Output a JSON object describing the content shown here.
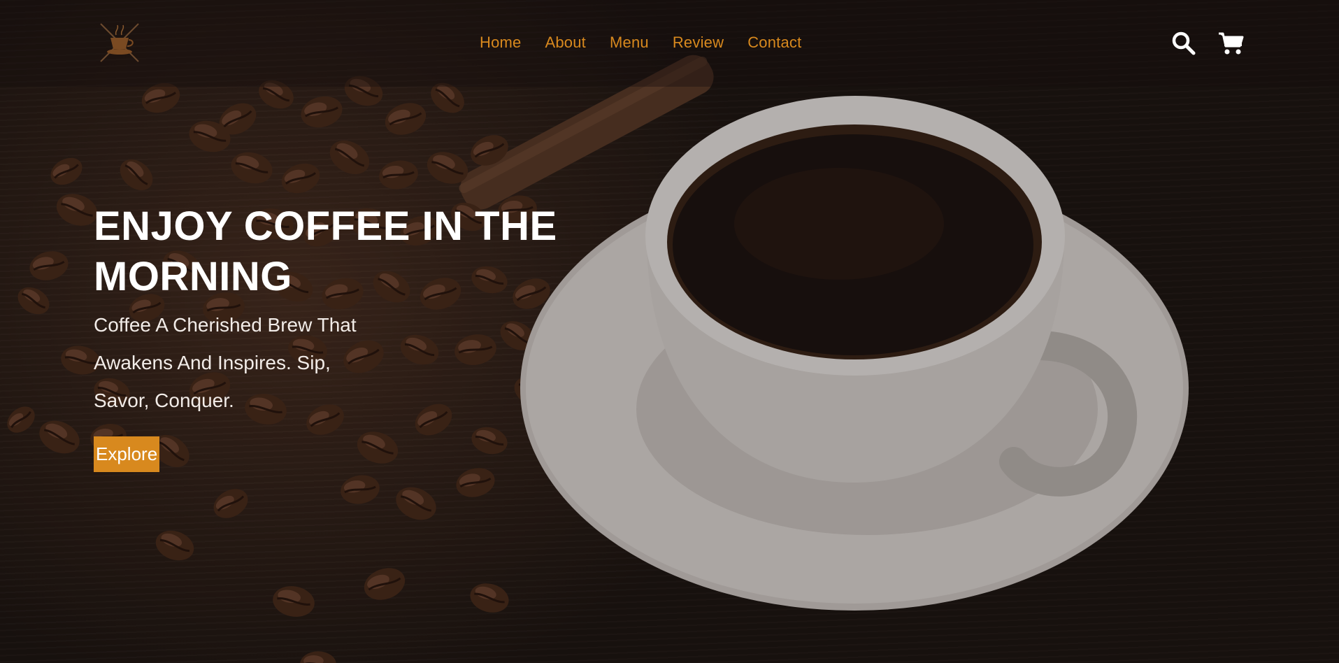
{
  "nav": {
    "logo_icon": "coffee-cup-logo-icon",
    "links": [
      {
        "label": "Home"
      },
      {
        "label": "About"
      },
      {
        "label": "Menu"
      },
      {
        "label": "Review"
      },
      {
        "label": "Contact"
      }
    ],
    "icons": {
      "search": "search-icon",
      "cart": "cart-icon"
    }
  },
  "hero": {
    "headline": "ENJOY COFFEE IN THE MORNING",
    "subtext": "Coffee A Cherished Brew That Awakens And Inspires. Sip, Savor, Conquer.",
    "cta_label": "Explore"
  },
  "colors": {
    "accent": "#d8891e",
    "text": "#ffffff"
  }
}
